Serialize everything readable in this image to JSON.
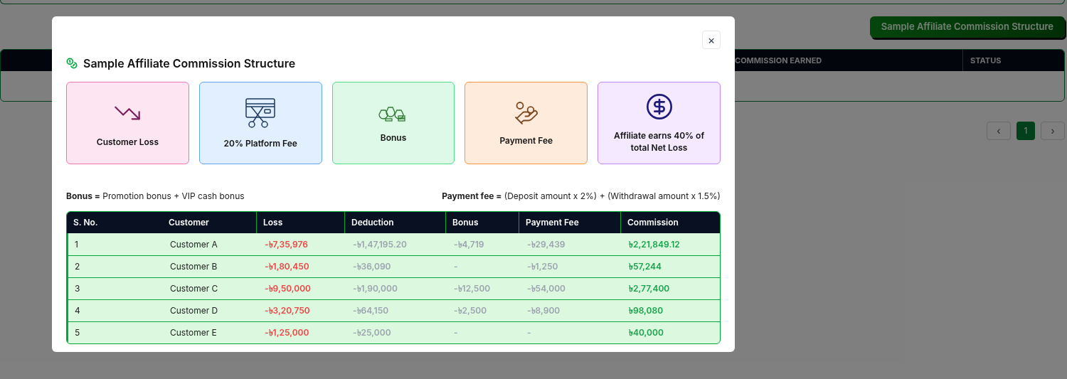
{
  "page": {
    "action_button": "Sample Affiliate Commission Structure",
    "table_columns": [
      "COMMISSION EARNED",
      "STATUS"
    ],
    "pagination": {
      "prev": "‹",
      "next": "›",
      "pages": [
        {
          "label": "1",
          "selected": true
        }
      ]
    }
  },
  "modal": {
    "title": "Sample Affiliate Commission Structure",
    "close": "×",
    "cards": [
      {
        "kind": "loss",
        "label": "Customer Loss",
        "color": "#f472b6"
      },
      {
        "kind": "fee",
        "label": "20% Platform Fee",
        "color": "#60a5fa"
      },
      {
        "kind": "bonus",
        "label": "Bonus",
        "color": "#4ade80"
      },
      {
        "kind": "payment",
        "label": "Payment Fee",
        "color": "#fb923c"
      },
      {
        "kind": "earn",
        "label": "Affiliate earns 40% of total Net Loss",
        "color": "#c084fc"
      }
    ],
    "notes": [
      "**Bonus =** Promotion bonus + VIP cash bonus",
      "**Payment fee =** (Deposit amount x 2%) + (Withdrawal amount x 1.5%)"
    ],
    "table": {
      "columns": [
        {
          "label": "S. No.",
          "kind": "plain"
        },
        {
          "label": "Customer",
          "kind": "plain"
        },
        {
          "label": "Loss",
          "kind": "loss"
        },
        {
          "label": "Deduction",
          "kind": "muted"
        },
        {
          "label": "Bonus",
          "kind": "muted"
        },
        {
          "label": "Payment Fee",
          "kind": "muted"
        },
        {
          "label": "Commission",
          "kind": "gain"
        }
      ],
      "rows": [
        [
          "1",
          "Customer A",
          "-৳7,35,976",
          "-৳1,47,195.20",
          "-৳4,719",
          "-৳29,439",
          "৳2,21,849.12"
        ],
        [
          "2",
          "Customer B",
          "-৳1,80,450",
          "-৳36,090",
          "-",
          "-৳1,250",
          "৳57,244"
        ],
        [
          "3",
          "Customer C",
          "-৳9,50,000",
          "-৳1,90,000",
          "-৳12,500",
          "-৳54,000",
          "৳2,77,400"
        ],
        [
          "4",
          "Customer D",
          "-৳3,20,750",
          "-৳64,150",
          "-৳2,500",
          "-৳8,900",
          "৳98,080"
        ],
        [
          "5",
          "Customer E",
          "-৳1,25,000",
          "-৳25,000",
          "-",
          "-",
          "৳40,000"
        ]
      ]
    }
  }
}
